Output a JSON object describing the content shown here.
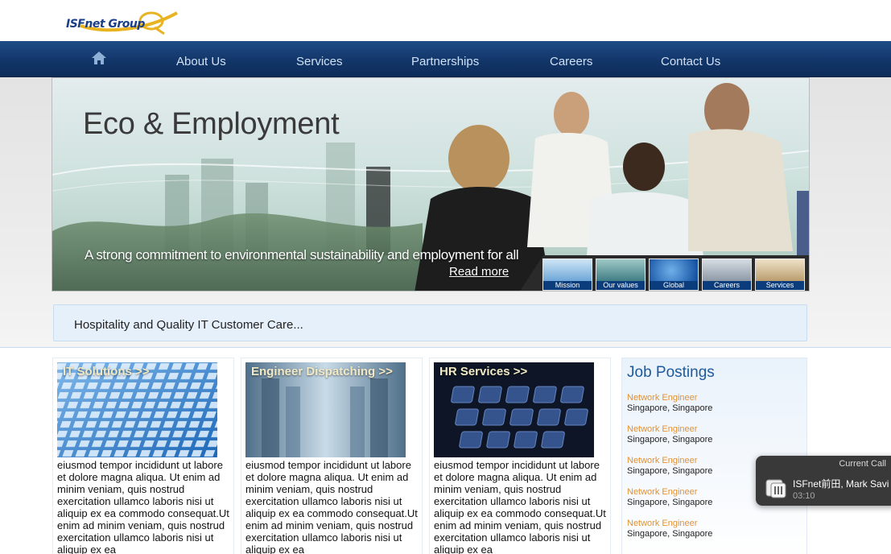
{
  "brand": {
    "logo_text": "ISFnet Group"
  },
  "nav": {
    "home_icon": "home-icon",
    "items": [
      {
        "label": "About Us"
      },
      {
        "label": "Services"
      },
      {
        "label": "Partnerships"
      },
      {
        "label": "Careers"
      },
      {
        "label": "Contact Us"
      }
    ]
  },
  "hero": {
    "title": "Eco & Employment",
    "tagline": "A strong commitment to environmental sustainability and employment for all",
    "read_more": "Read more",
    "thumbnails": [
      {
        "label": "Mission"
      },
      {
        "label": "Our values"
      },
      {
        "label": "Global"
      },
      {
        "label": "Careers"
      },
      {
        "label": "Services"
      }
    ]
  },
  "care_banner": "Hospitality and Quality IT Customer Care...",
  "columns": [
    {
      "title": "IT Solutions >>",
      "text": "eiusmod tempor incididunt ut labore et dolore magna aliqua. Ut enim ad minim veniam, quis nostrud exercitation ullamco laboris nisi ut aliquip ex ea commodo consequat.Ut enim ad minim veniam, quis nostrud exercitation ullamco laboris nisi ut aliquip ex ea"
    },
    {
      "title": "Engineer Dispatching >>",
      "text": "eiusmod tempor incididunt ut labore et dolore magna aliqua. Ut enim ad minim veniam, quis nostrud exercitation ullamco laboris nisi ut aliquip ex ea commodo consequat.Ut enim ad minim veniam, quis nostrud exercitation ullamco laboris nisi ut aliquip ex ea"
    },
    {
      "title": "HR Services >>",
      "text": "eiusmod tempor incididunt ut labore et dolore magna aliqua. Ut enim ad minim veniam, quis nostrud exercitation ullamco laboris nisi ut aliquip ex ea commodo consequat.Ut enim ad minim veniam, quis nostrud exercitation ullamco laboris nisi ut aliquip ex ea"
    }
  ],
  "jobs": {
    "title": "Job Postings",
    "items": [
      {
        "title": "Network Engineer",
        "location": "Singapore, Singapore"
      },
      {
        "title": "Network Engineer",
        "location": "Singapore, Singapore"
      },
      {
        "title": "Network Engineer",
        "location": "Singapore, Singapore"
      },
      {
        "title": "Network Engineer",
        "location": "Singapore, Singapore"
      },
      {
        "title": "Network Engineer",
        "location": "Singapore, Singapore"
      }
    ]
  },
  "call_popup": {
    "header": "Current Call",
    "caller": "ISFnet前田, Mark Savi",
    "duration": "03:10"
  },
  "colors": {
    "nav_bg": "#123669",
    "nav_text": "#cfe0f5",
    "job_title": "#e6912c",
    "jobs_heading": "#1c5a9e",
    "care_bg": "#e6f0fb"
  }
}
